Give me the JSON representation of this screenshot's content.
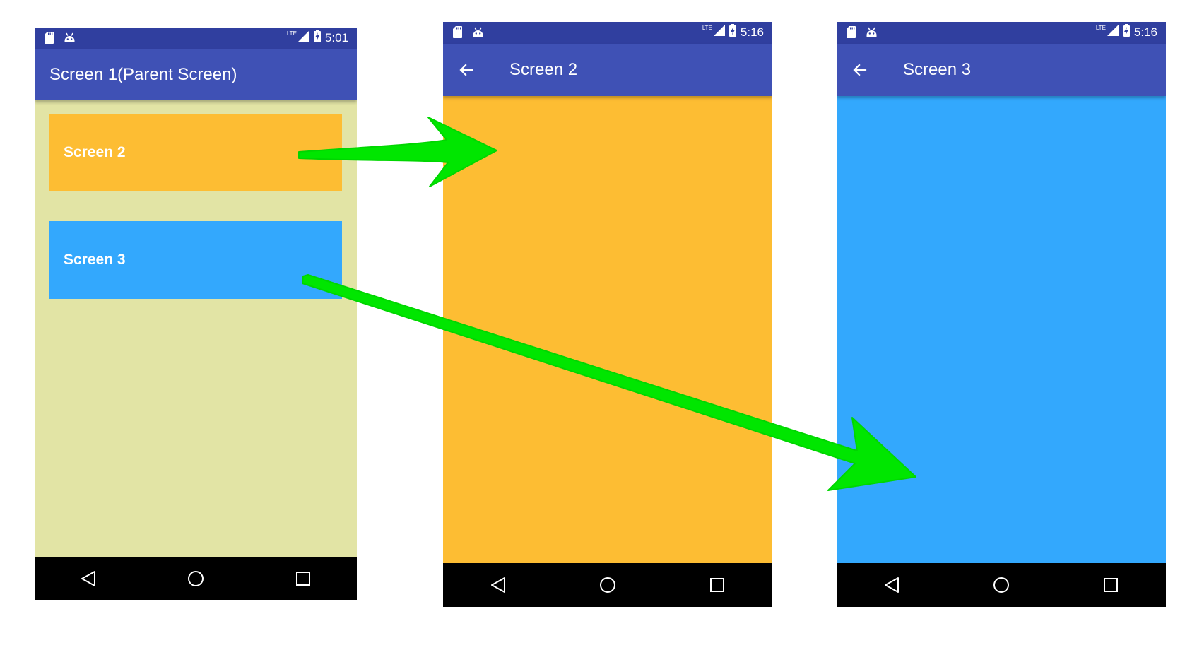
{
  "colors": {
    "status_bar": "#303f9f",
    "app_bar": "#3f51b5",
    "screen1_background": "#e2e4a5",
    "screen2_color": "#fdbd33",
    "screen3_color": "#33a8fd",
    "arrow": "#00e600",
    "nav_bar": "#000000"
  },
  "phones": [
    {
      "status_bar": {
        "network": "LTE",
        "time": "5:01",
        "icons": [
          "sd-card-icon",
          "android-icon",
          "signal-icon",
          "battery-charging-icon"
        ]
      },
      "app_bar": {
        "title": "Screen 1(Parent Screen)"
      },
      "cards": [
        {
          "label": "Screen 2"
        },
        {
          "label": "Screen 3"
        }
      ],
      "nav_bar": {
        "icons": [
          "back-nav-icon",
          "home-nav-icon",
          "recents-nav-icon"
        ]
      }
    },
    {
      "status_bar": {
        "network": "LTE",
        "time": "5:16",
        "icons": [
          "sd-card-icon",
          "android-icon",
          "signal-icon",
          "battery-charging-icon"
        ]
      },
      "app_bar": {
        "title": "Screen 2",
        "back_icon": "arrow-left-icon"
      },
      "nav_bar": {
        "icons": [
          "back-nav-icon",
          "home-nav-icon",
          "recents-nav-icon"
        ]
      }
    },
    {
      "status_bar": {
        "network": "LTE",
        "time": "5:16",
        "icons": [
          "sd-card-icon",
          "android-icon",
          "signal-icon",
          "battery-charging-icon"
        ]
      },
      "app_bar": {
        "title": "Screen 3",
        "back_icon": "arrow-left-icon"
      },
      "nav_bar": {
        "icons": [
          "back-nav-icon",
          "home-nav-icon",
          "recents-nav-icon"
        ]
      }
    }
  ]
}
